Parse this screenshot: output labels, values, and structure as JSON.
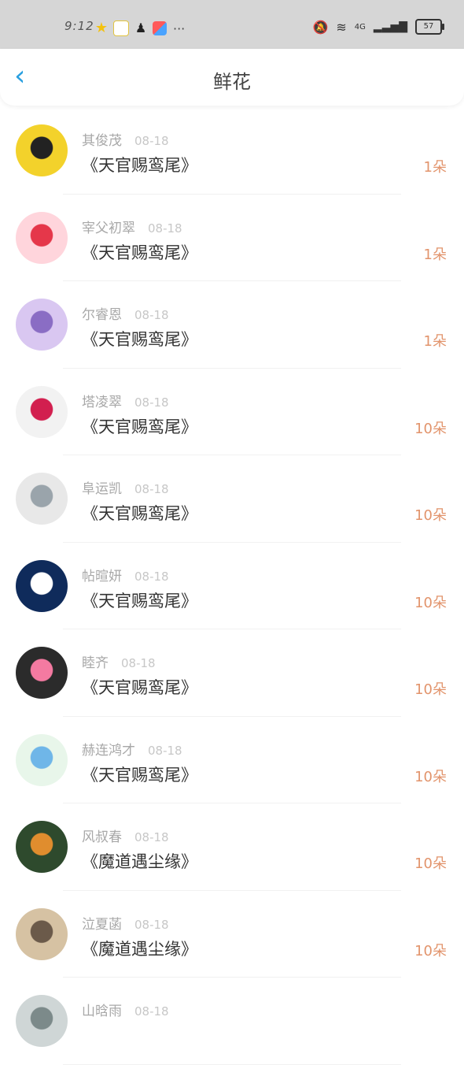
{
  "status": {
    "time": "9:12",
    "battery": "57",
    "network": "4G",
    "more": "···"
  },
  "header": {
    "title": "鲜花"
  },
  "rows": [
    {
      "name": "其俊茂",
      "date": "08-18",
      "book": "《天官赐鸾尾》",
      "count": "1朵",
      "avatar_colors": [
        "#f3d22b",
        "#222222"
      ]
    },
    {
      "name": "宰父初翠",
      "date": "08-18",
      "book": "《天官赐鸾尾》",
      "count": "1朵",
      "avatar_colors": [
        "#ffd5dc",
        "#e5374a"
      ]
    },
    {
      "name": "尔睿恩",
      "date": "08-18",
      "book": "《天官赐鸾尾》",
      "count": "1朵",
      "avatar_colors": [
        "#d9c7f1",
        "#8a6dc4"
      ]
    },
    {
      "name": "塔凌翠",
      "date": "08-18",
      "book": "《天官赐鸾尾》",
      "count": "10朵",
      "avatar_colors": [
        "#f2f2f2",
        "#d21f4f"
      ]
    },
    {
      "name": "阜运凯",
      "date": "08-18",
      "book": "《天官赐鸾尾》",
      "count": "10朵",
      "avatar_colors": [
        "#e8e8e8",
        "#9aa4ab"
      ]
    },
    {
      "name": "帖暄妍",
      "date": "08-18",
      "book": "《天官赐鸾尾》",
      "count": "10朵",
      "avatar_colors": [
        "#0f2b5b",
        "#ffffff"
      ]
    },
    {
      "name": "睦齐",
      "date": "08-18",
      "book": "《天官赐鸾尾》",
      "count": "10朵",
      "avatar_colors": [
        "#2b2b2b",
        "#f47aa1"
      ]
    },
    {
      "name": "赫连鸿才",
      "date": "08-18",
      "book": "《天官赐鸾尾》",
      "count": "10朵",
      "avatar_colors": [
        "#e8f6ea",
        "#6fb6e8"
      ]
    },
    {
      "name": "风叔春",
      "date": "08-18",
      "book": "《魔道遇尘缘》",
      "count": "10朵",
      "avatar_colors": [
        "#2e4a2d",
        "#e08d2e"
      ]
    },
    {
      "name": "泣夏菡",
      "date": "08-18",
      "book": "《魔道遇尘缘》",
      "count": "10朵",
      "avatar_colors": [
        "#d6c2a3",
        "#6b5a4a"
      ]
    },
    {
      "name": "山晗雨",
      "date": "08-18",
      "book": "",
      "count": "",
      "avatar_colors": [
        "#cfd6d6",
        "#7c8a8a"
      ]
    }
  ],
  "colors": {
    "accent": "#2aa0e0",
    "count": "#e2946c",
    "status_bar": "#d6d6d6"
  }
}
